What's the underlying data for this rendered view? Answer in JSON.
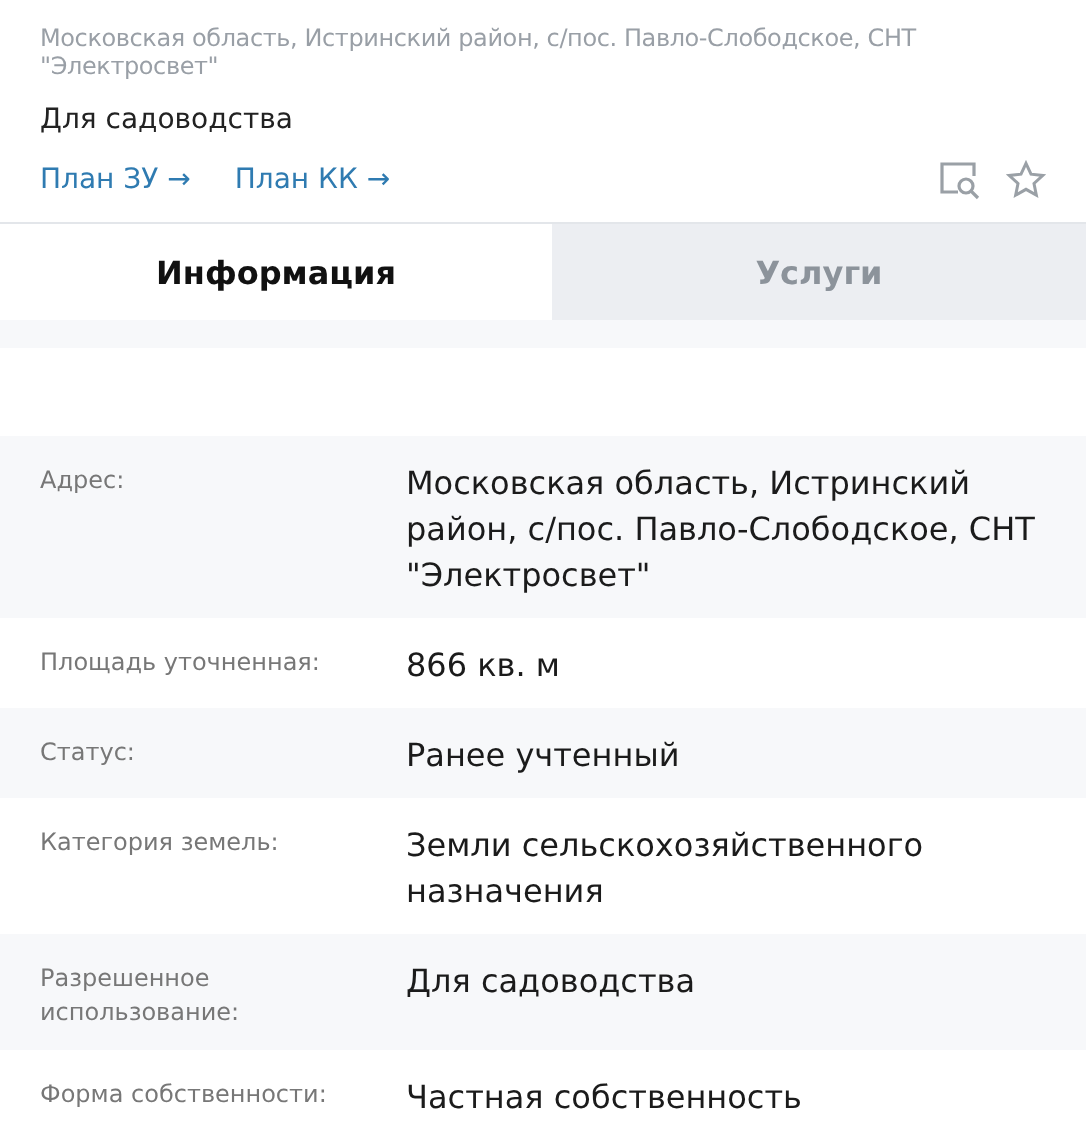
{
  "header": {
    "address": "Московская область, Истринский район, с/пос. Павло-Слободское, СНТ \"Электросвет\"",
    "purpose": "Для садоводства",
    "links": [
      {
        "label": "План ЗУ",
        "arrow": "→"
      },
      {
        "label": "План КК",
        "arrow": "→"
      }
    ]
  },
  "tabs": [
    {
      "label": "Информация",
      "selected": true
    },
    {
      "label": "Услуги",
      "selected": false
    }
  ],
  "rows": [
    {
      "label": "Адрес:",
      "value": "Московская область, Истринский район, с/пос. Павло-Слободское, СНТ \"Электросвет\""
    },
    {
      "label": "Площадь уточненная:",
      "value": "866 кв. м"
    },
    {
      "label": "Статус:",
      "value": "Ранее учтенный"
    },
    {
      "label": "Категория земель:",
      "value": "Земли сельскохозяйственного назначения"
    },
    {
      "label": "Разрешенное использование:",
      "value": "Для садоводства"
    },
    {
      "label": "Форма собственности:",
      "value": "Частная собственность"
    }
  ]
}
